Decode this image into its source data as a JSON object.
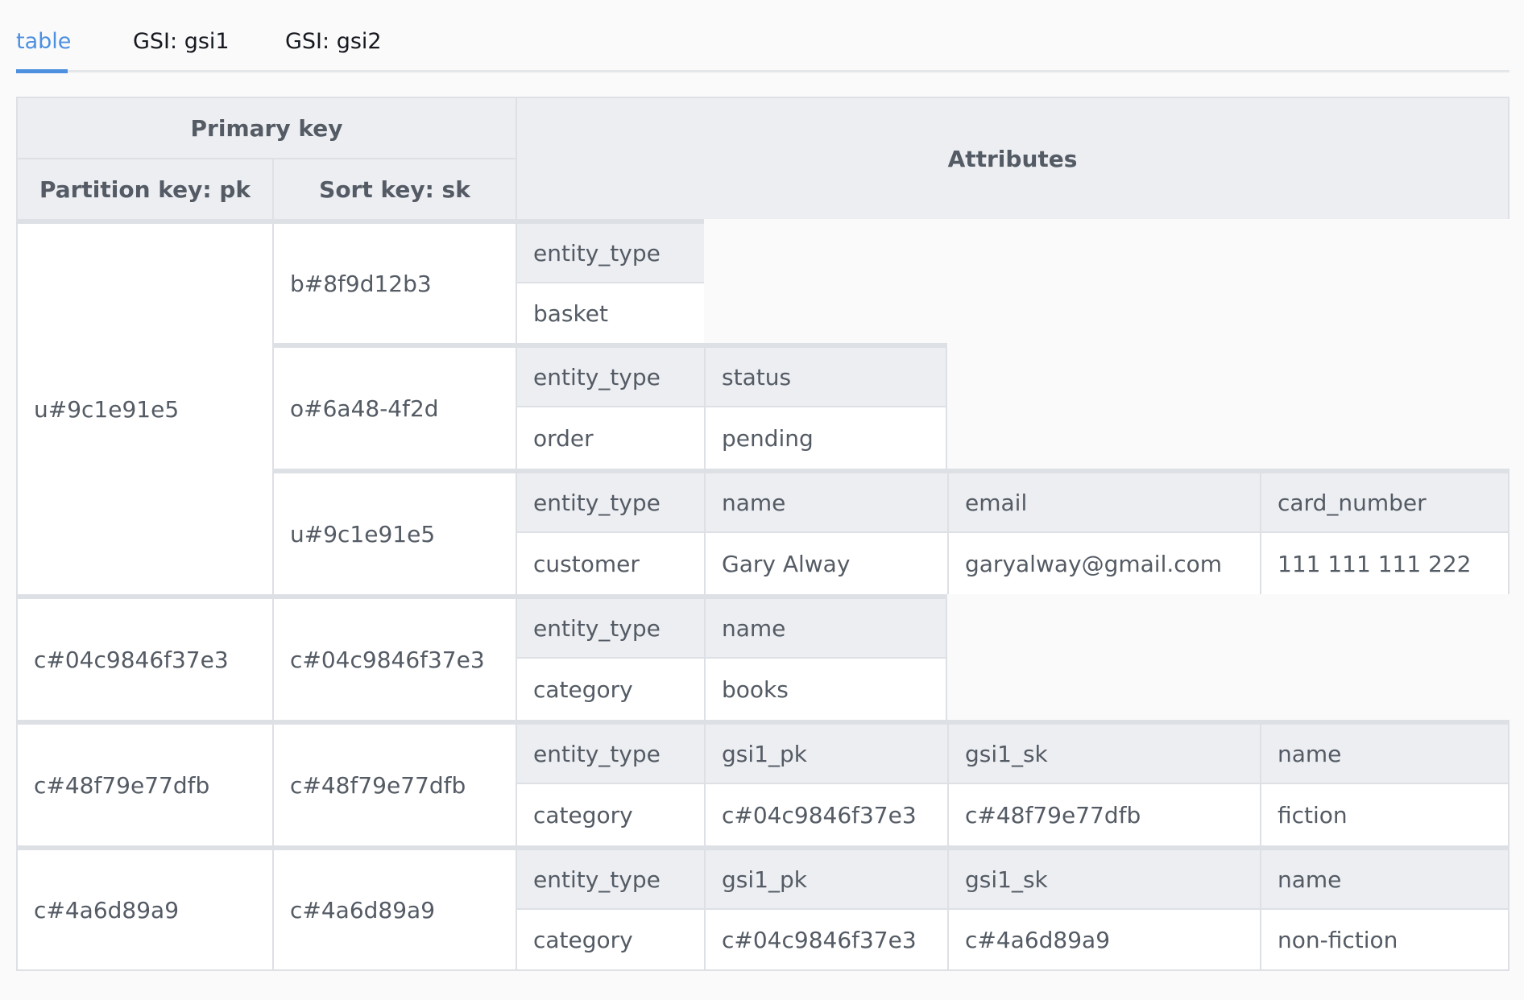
{
  "tabs": [
    {
      "label": "table",
      "active": true
    },
    {
      "label": "GSI: gsi1",
      "active": false
    },
    {
      "label": "GSI: gsi2",
      "active": false
    }
  ],
  "headers": {
    "primary_key": "Primary key",
    "partition_key": "Partition key: pk",
    "sort_key": "Sort key: sk",
    "attributes": "Attributes"
  },
  "items": [
    {
      "pk": "u#9c1e91e5",
      "sk": "b#8f9d12b3",
      "attrs": [
        {
          "name": "entity_type",
          "value": "basket"
        }
      ]
    },
    {
      "pk": "u#9c1e91e5",
      "sk": "o#6a48-4f2d",
      "attrs": [
        {
          "name": "entity_type",
          "value": "order"
        },
        {
          "name": "status",
          "value": "pending"
        }
      ]
    },
    {
      "pk": "u#9c1e91e5",
      "sk": "u#9c1e91e5",
      "attrs": [
        {
          "name": "entity_type",
          "value": "customer"
        },
        {
          "name": "name",
          "value": "Gary Alway"
        },
        {
          "name": "email",
          "value": "garyalway@gmail.com"
        },
        {
          "name": "card_number",
          "value": "111 111 111 222"
        }
      ]
    },
    {
      "pk": "c#04c9846f37e3",
      "sk": "c#04c9846f37e3",
      "attrs": [
        {
          "name": "entity_type",
          "value": "category"
        },
        {
          "name": "name",
          "value": "books"
        }
      ]
    },
    {
      "pk": "c#48f79e77dfb",
      "sk": "c#48f79e77dfb",
      "attrs": [
        {
          "name": "entity_type",
          "value": "category"
        },
        {
          "name": "gsi1_pk",
          "value": "c#04c9846f37e3"
        },
        {
          "name": "gsi1_sk",
          "value": "c#48f79e77dfb"
        },
        {
          "name": "name",
          "value": "fiction"
        }
      ]
    },
    {
      "pk": "c#4a6d89a9",
      "sk": "c#4a6d89a9",
      "attrs": [
        {
          "name": "entity_type",
          "value": "category"
        },
        {
          "name": "gsi1_pk",
          "value": "c#04c9846f37e3"
        },
        {
          "name": "gsi1_sk",
          "value": "c#4a6d89a9"
        },
        {
          "name": "name",
          "value": "non-fiction"
        }
      ]
    }
  ],
  "colors": {
    "accent": "#4d90e0",
    "header_bg": "#eceef2",
    "border": "#dde0e4",
    "text": "#545b64"
  }
}
